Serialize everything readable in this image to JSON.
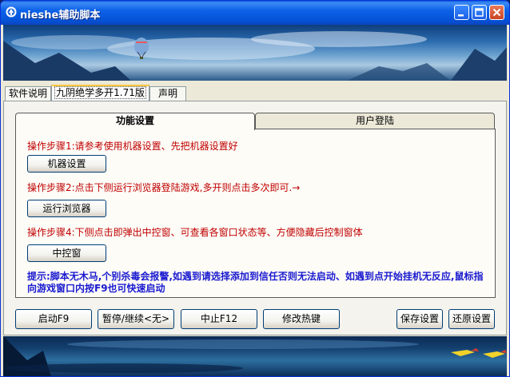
{
  "window": {
    "title": "nieshe辅助脚本"
  },
  "top_tabs": [
    {
      "label": "软件说明"
    },
    {
      "label": "九阴绝学多开1.71版"
    },
    {
      "label": "声明"
    }
  ],
  "inner_tabs": [
    {
      "label": "功能设置"
    },
    {
      "label": "用户登陆"
    }
  ],
  "steps": {
    "step1": "操作步骤1:请参考使用机器设置、先把机器设置好",
    "step2": "操作步骤2:点击下侧运行浏览器登陆游戏,多开则点击多次即可.→",
    "step4": "操作步骤4:下侧点击即弹出中控窗、可查看各窗口状态等、方便隐藏后控制窗体"
  },
  "buttons": {
    "machine_settings": "机器设置",
    "run_browser": "运行浏览器",
    "control_window": "中控窗",
    "start": "启动F9",
    "pause": "暂停/继续<无>",
    "stop": "中止F12",
    "hotkey": "修改热键",
    "save": "保存设置",
    "restore": "还原设置"
  },
  "hint": "提示:脚本无木马,个别杀毒会报警,如遇到请选择添加到信任否则无法启动、如遇到点开始挂机无反应,鼠标指向游戏窗口内按F9也可快速启动"
}
